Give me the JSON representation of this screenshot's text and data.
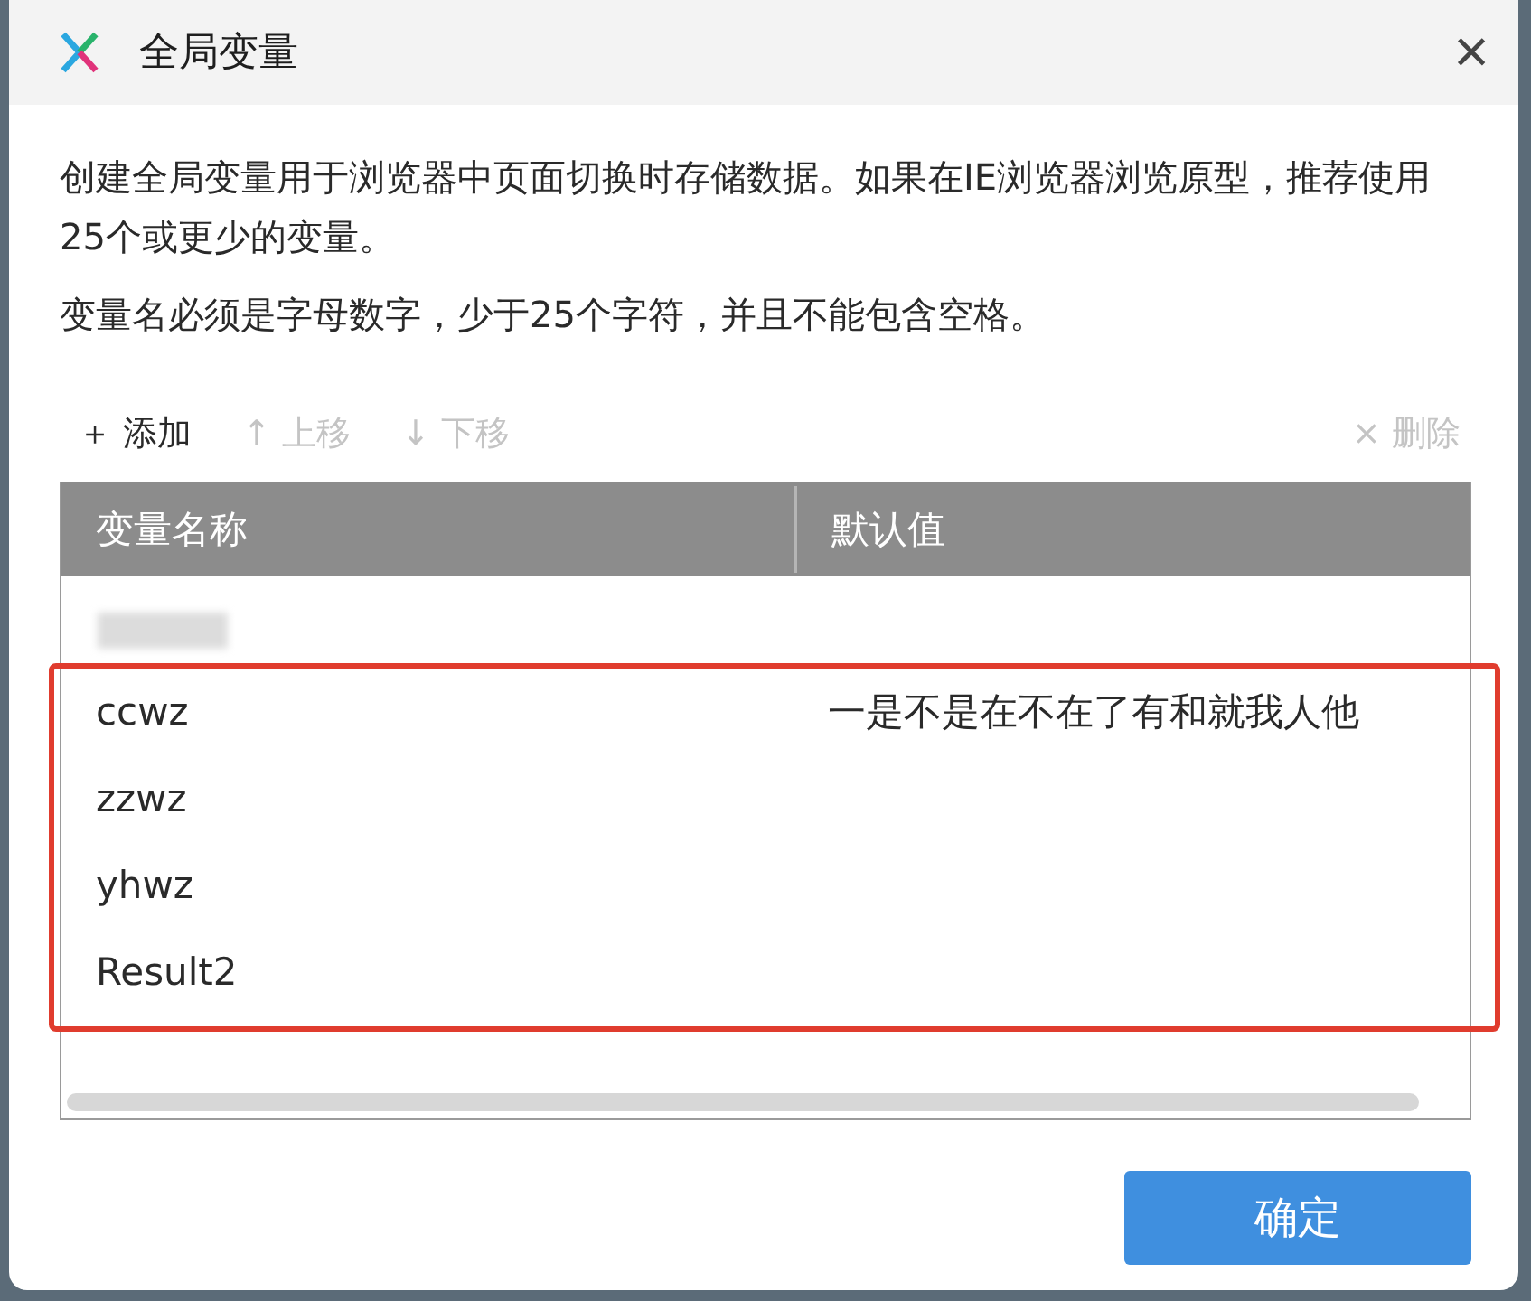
{
  "window": {
    "title": "全局变量",
    "close": "×"
  },
  "description": [
    "创建全局变量用于浏览器中页面切换时存储数据。如果在IE浏览器浏览原型，推荐使用25个或更少的变量。",
    "变量名必须是字母数字，少于25个字符，并且不能包含空格。"
  ],
  "toolbar": [
    {
      "kind": "add",
      "icon": "＋",
      "label": "添加",
      "disabled": false
    },
    {
      "kind": "up",
      "icon": "↑",
      "label": "上移",
      "disabled": true
    },
    {
      "kind": "down",
      "icon": "↓",
      "label": "下移",
      "disabled": true
    },
    {
      "kind": "delete",
      "icon": "×",
      "label": "删除",
      "disabled": true
    }
  ],
  "table": {
    "columns": [
      "变量名称",
      "默认值"
    ],
    "rows": [
      {
        "kind": "blurred",
        "highlighted": false
      },
      {
        "kind": "text",
        "name": "ccwz",
        "value": "一是不是在不在了有和就我人他",
        "highlighted": true
      },
      {
        "kind": "text",
        "name": "zzwz",
        "highlighted": true
      },
      {
        "kind": "text",
        "name": "yhwz",
        "highlighted": true
      },
      {
        "kind": "text",
        "name": "Result2",
        "highlighted": true
      }
    ]
  },
  "buttons": [
    "确定"
  ]
}
